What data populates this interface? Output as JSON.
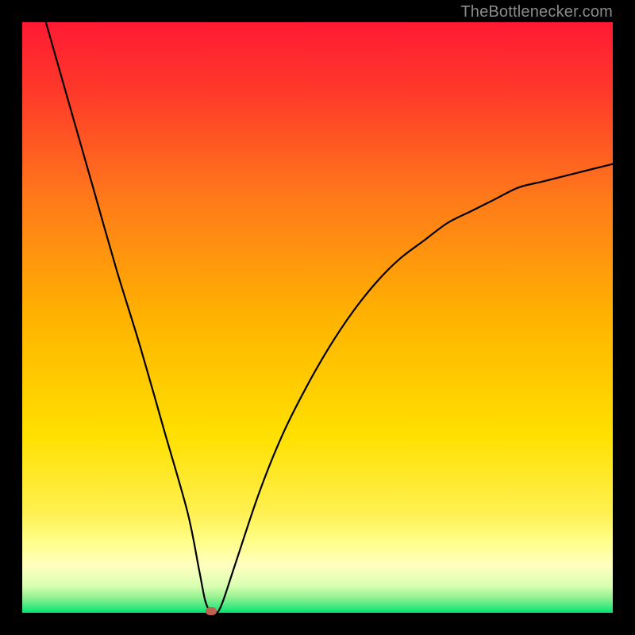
{
  "watermark": {
    "text": "TheBottlenecker.com"
  },
  "colors": {
    "gradient_top": "#ff1a33",
    "gradient_mid": "#ffd400",
    "gradient_yellowband": "#ffff8a",
    "gradient_bottom": "#00e56a",
    "curve": "#000000",
    "marker": "#c06050",
    "frame": "#000000"
  },
  "chart_data": {
    "type": "line",
    "title": "",
    "xlabel": "",
    "ylabel": "",
    "xlim": [
      0,
      100
    ],
    "ylim": [
      0,
      100
    ],
    "grid": false,
    "legend": false,
    "marker": {
      "x": 32,
      "y": 0
    },
    "series": [
      {
        "name": "bottleneck-curve",
        "x": [
          4,
          8,
          12,
          16,
          20,
          24,
          28,
          30,
          31,
          32,
          33,
          34,
          36,
          40,
          44,
          48,
          52,
          56,
          60,
          64,
          68,
          72,
          76,
          80,
          84,
          88,
          92,
          96,
          100
        ],
        "y": [
          100,
          86,
          72,
          58,
          45,
          31,
          17,
          7,
          2,
          0,
          0,
          2,
          8,
          20,
          30,
          38,
          45,
          51,
          56,
          60,
          63,
          66,
          68,
          70,
          72,
          73,
          74,
          75,
          76
        ]
      }
    ]
  }
}
